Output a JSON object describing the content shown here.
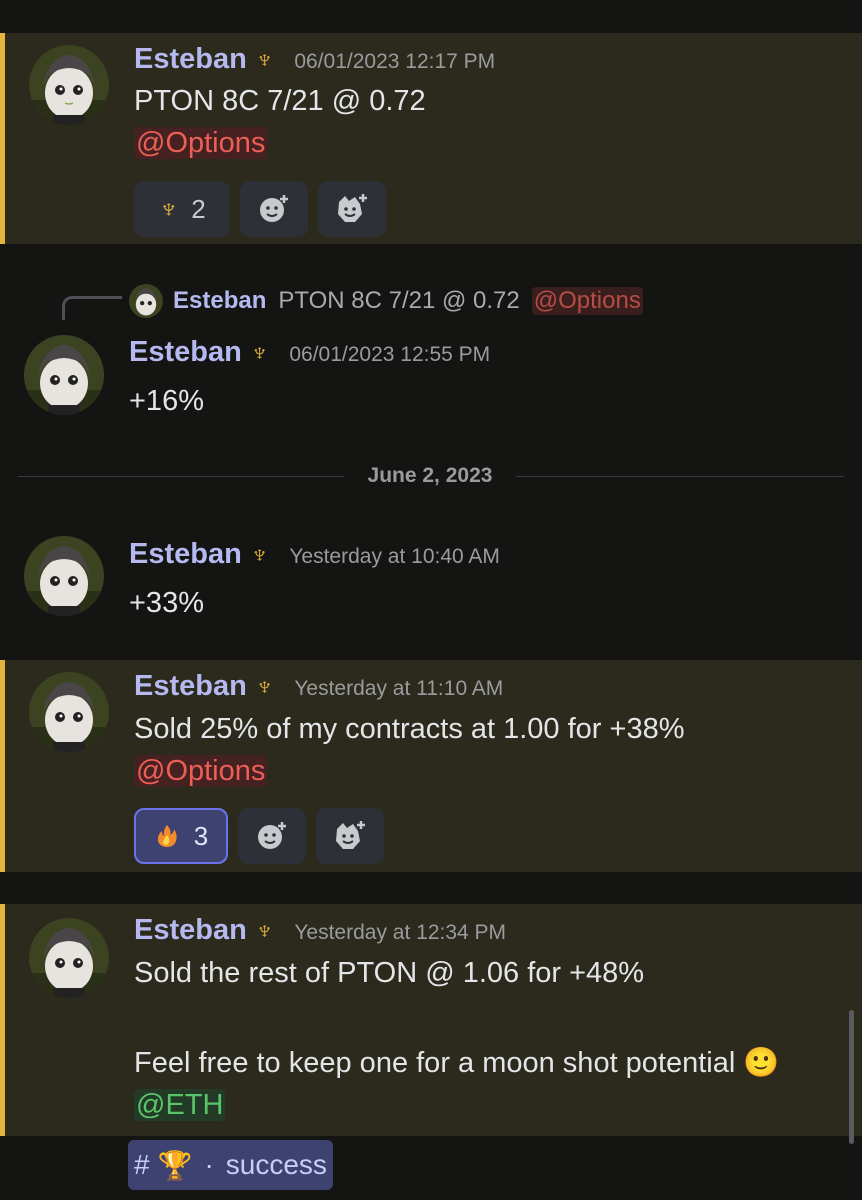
{
  "messages": [
    {
      "username": "Esteban",
      "badge": "♆",
      "timestamp": "06/01/2023 12:17 PM",
      "text": "PTON 8C 7/21 @ 0.72",
      "mention": "@Options",
      "reactions": [
        {
          "emoji": "trident",
          "count": "2"
        }
      ]
    },
    {
      "username": "Esteban",
      "badge": "♆",
      "timestamp": "06/01/2023 12:55 PM",
      "text": "+16%",
      "reply": {
        "username": "Esteban",
        "text": "PTON 8C 7/21 @ 0.72",
        "mention": "@Options"
      }
    },
    {
      "username": "Esteban",
      "badge": "♆",
      "timestamp": "Yesterday at 10:40 AM",
      "text": "+33%"
    },
    {
      "username": "Esteban",
      "badge": "♆",
      "timestamp": "Yesterday at 11:10 AM",
      "text": "Sold 25% of my contracts at 1.00 for +38%",
      "mention": "@Options",
      "reactions": [
        {
          "emoji": "fire",
          "count": "3"
        }
      ]
    },
    {
      "username": "Esteban",
      "badge": "♆",
      "timestamp": "Yesterday at 12:34 PM",
      "text": "Sold the rest of PTON @ 1.06 for +48%",
      "text2": "Feel free to keep one for a moon shot potential 🙂",
      "mention": "@ETH"
    }
  ],
  "date_divider": "June 2, 2023",
  "channel_chip": {
    "hash": "#",
    "trophy": "🏆",
    "separator": "·",
    "name": "success"
  },
  "colors": {
    "background": "#141512",
    "highlight_bg": "#2b2a1c",
    "highlight_bar": "#e5b43b",
    "username": "#b5b9ef",
    "mention_red": "#ec5f55",
    "mention_green": "#59c46b"
  },
  "icons": [
    "avatar-image",
    "trident-icon",
    "add-reaction-icon",
    "super-reaction-icon",
    "fire-icon",
    "trophy-icon"
  ]
}
